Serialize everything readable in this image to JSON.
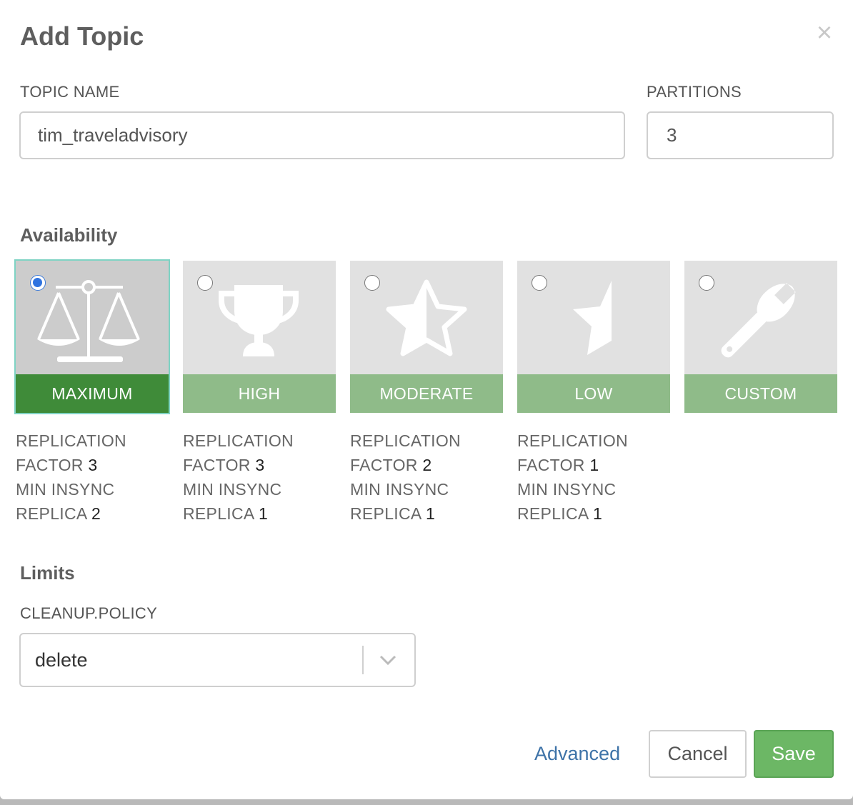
{
  "dialog": {
    "title": "Add Topic",
    "close_glyph": "×"
  },
  "form": {
    "topic_name_label": "TOPIC NAME",
    "topic_name_value": "tim_traveladvisory",
    "partitions_label": "PARTITIONS",
    "partitions_value": "3"
  },
  "availability": {
    "heading": "Availability",
    "selected": "MAXIMUM",
    "options": [
      {
        "label": "MAXIMUM",
        "icon": "scales-icon",
        "selected": true,
        "replication_factor": "3",
        "min_insync_replica": "2"
      },
      {
        "label": "HIGH",
        "icon": "trophy-icon",
        "selected": false,
        "replication_factor": "3",
        "min_insync_replica": "1"
      },
      {
        "label": "MODERATE",
        "icon": "half-star-icon",
        "selected": false,
        "replication_factor": "2",
        "min_insync_replica": "1"
      },
      {
        "label": "LOW",
        "icon": "star-sliver-icon",
        "selected": false,
        "replication_factor": "1",
        "min_insync_replica": "1"
      },
      {
        "label": "CUSTOM",
        "icon": "wrench-icon",
        "selected": false
      }
    ],
    "spec_labels": {
      "replication": "REPLICATION",
      "factor": "FACTOR",
      "min_insync": "MIN INSYNC",
      "replica": "REPLICA"
    }
  },
  "limits": {
    "heading": "Limits",
    "cleanup_label": "CLEANUP.POLICY",
    "cleanup_value": "delete"
  },
  "footer": {
    "advanced_label": "Advanced",
    "cancel_label": "Cancel",
    "save_label": "Save"
  },
  "colors": {
    "selected_band": "#3f8b39",
    "band": "#8fbb89",
    "save_button": "#6cb765",
    "link": "#3e73a8"
  }
}
